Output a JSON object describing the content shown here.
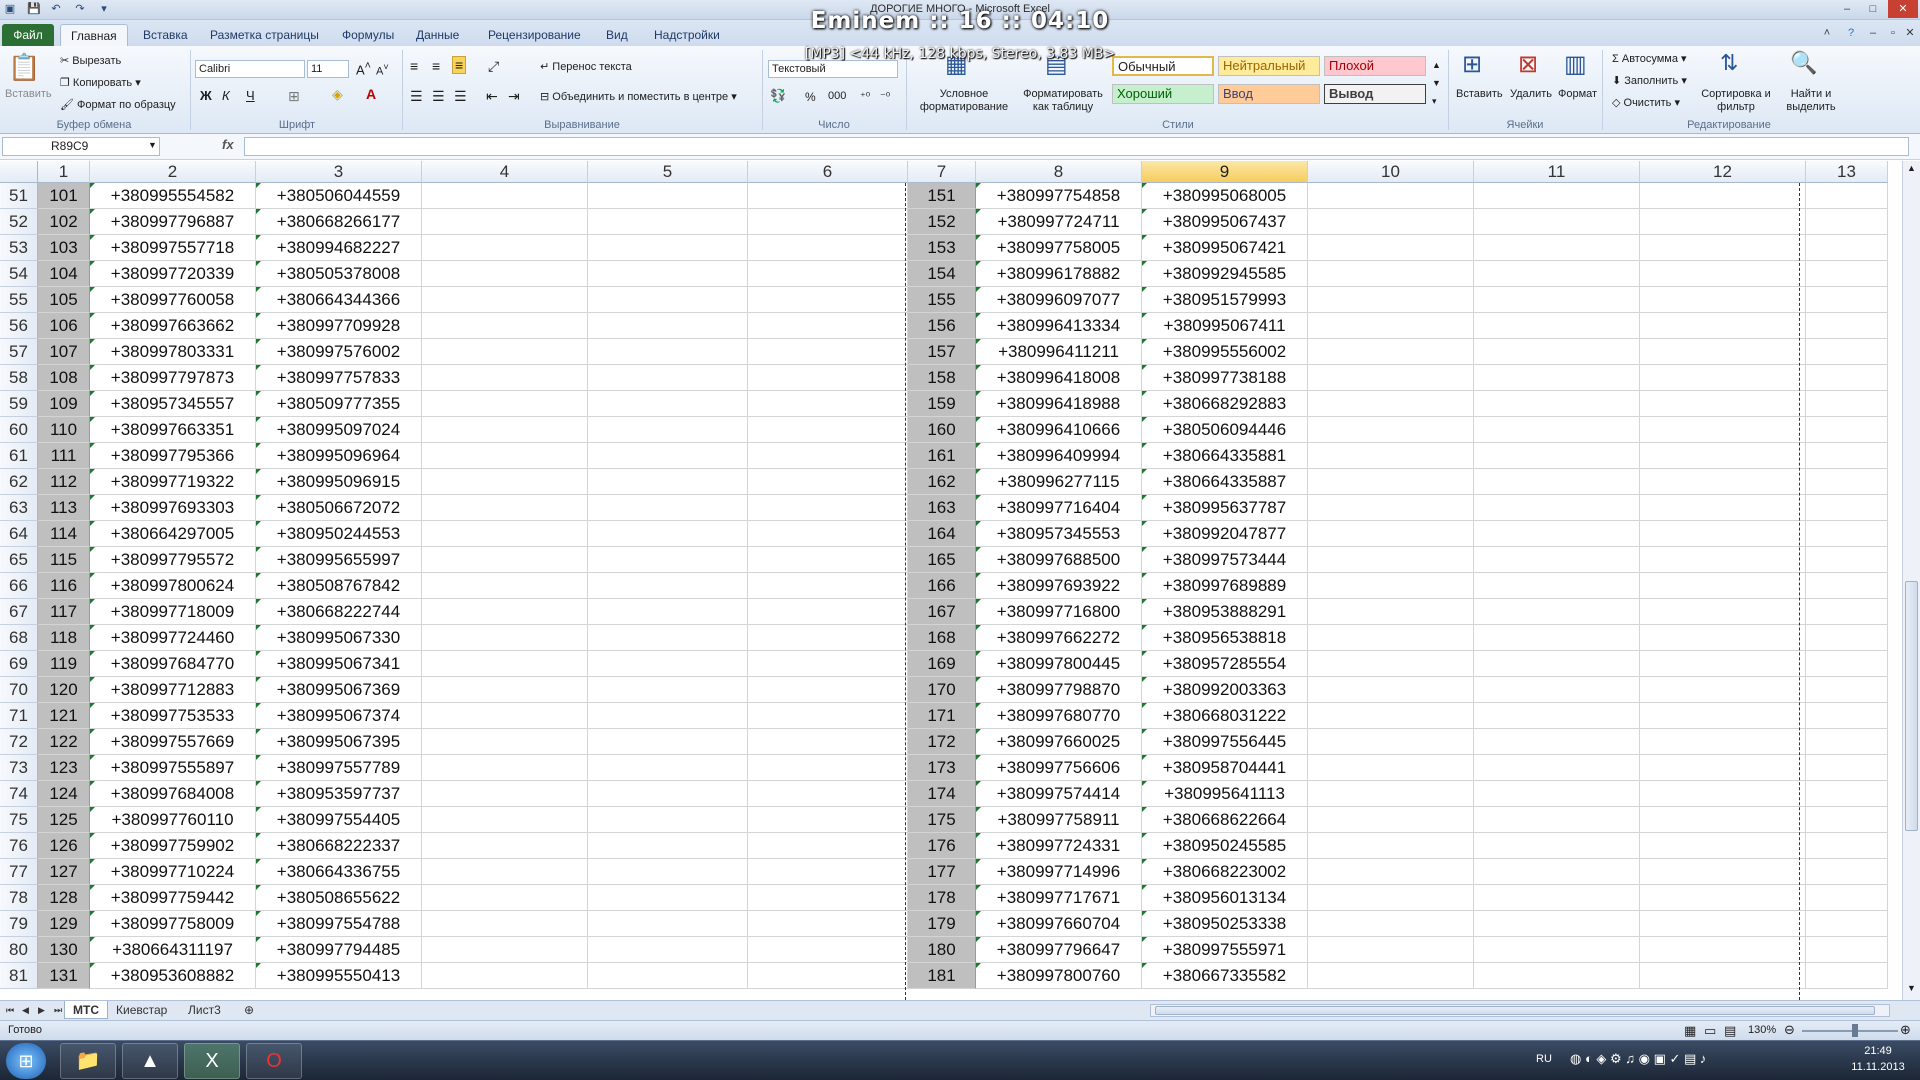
{
  "window": {
    "title": "ДОРОГИЕ МНОГО - Microsoft Excel"
  },
  "overlay": {
    "title": "Eminem :: 16 :: 04:10",
    "subtitle": "[MP3] <44 kHz, 128 kbps, Stereo, 3.83 MB>"
  },
  "tabs": [
    "Файл",
    "Главная",
    "Вставка",
    "Разметка страницы",
    "Формулы",
    "Данные",
    "Рецензирование",
    "Вид",
    "Надстройки"
  ],
  "ribbon": {
    "clipboard": {
      "paste": "Вставить",
      "cut": "Вырезать",
      "copy": "Копировать",
      "format_painter": "Формат по образцу",
      "label": "Буфер обмена"
    },
    "font": {
      "name": "Calibri",
      "size": "11",
      "bold": "Ж",
      "italic": "К",
      "underline": "Ч",
      "label": "Шрифт"
    },
    "alignment": {
      "wrap": "Перенос текста",
      "merge": "Объединить и поместить в центре",
      "label": "Выравнивание"
    },
    "number": {
      "format": "Текстовый",
      "percent": "%",
      "thousands": "000",
      "label": "Число"
    },
    "styles": {
      "conditional": "Условное форматирование",
      "as_table": "Форматировать как таблицу",
      "normal": "Обычный",
      "neutral": "Нейтральный",
      "bad": "Плохой",
      "good": "Хороший",
      "input": "Ввод",
      "output": "Вывод",
      "label": "Стили"
    },
    "cells": {
      "insert": "Вставить",
      "delete": "Удалить",
      "format": "Формат",
      "label": "Ячейки"
    },
    "editing": {
      "autosum": "Автосумма",
      "fill": "Заполнить",
      "clear": "Очистить",
      "sort": "Сортировка и фильтр",
      "find": "Найти и выделить",
      "label": "Редактирование"
    }
  },
  "formula_bar": {
    "name_box": "R89C9",
    "fx": "fx",
    "value": ""
  },
  "columns": [
    "1",
    "2",
    "3",
    "4",
    "5",
    "6",
    "7",
    "8",
    "9",
    "10",
    "11",
    "12",
    "13"
  ],
  "selected_column": "9",
  "rows": [
    {
      "r": "51",
      "a": "101",
      "b": "+380995554582",
      "c": "+380506044559",
      "g": "151",
      "h": "+380997754858",
      "i": "+380995068005"
    },
    {
      "r": "52",
      "a": "102",
      "b": "+380997796887",
      "c": "+380668266177",
      "g": "152",
      "h": "+380997724711",
      "i": "+380995067437"
    },
    {
      "r": "53",
      "a": "103",
      "b": "+380997557718",
      "c": "+380994682227",
      "g": "153",
      "h": "+380997758005",
      "i": "+380995067421"
    },
    {
      "r": "54",
      "a": "104",
      "b": "+380997720339",
      "c": "+380505378008",
      "g": "154",
      "h": "+380996178882",
      "i": "+380992945585"
    },
    {
      "r": "55",
      "a": "105",
      "b": "+380997760058",
      "c": "+380664344366",
      "g": "155",
      "h": "+380996097077",
      "i": "+380951579993"
    },
    {
      "r": "56",
      "a": "106",
      "b": "+380997663662",
      "c": "+380997709928",
      "g": "156",
      "h": "+380996413334",
      "i": "+380995067411"
    },
    {
      "r": "57",
      "a": "107",
      "b": "+380997803331",
      "c": "+380997576002",
      "g": "157",
      "h": "+380996411211",
      "i": "+380995556002"
    },
    {
      "r": "58",
      "a": "108",
      "b": "+380997797873",
      "c": "+380997757833",
      "g": "158",
      "h": "+380996418008",
      "i": "+380997738188"
    },
    {
      "r": "59",
      "a": "109",
      "b": "+380957345557",
      "c": "+380509777355",
      "g": "159",
      "h": "+380996418988",
      "i": "+380668292883"
    },
    {
      "r": "60",
      "a": "110",
      "b": "+380997663351",
      "c": "+380995097024",
      "g": "160",
      "h": "+380996410666",
      "i": "+380506094446"
    },
    {
      "r": "61",
      "a": "111",
      "b": "+380997795366",
      "c": "+380995096964",
      "g": "161",
      "h": "+380996409994",
      "i": "+380664335881"
    },
    {
      "r": "62",
      "a": "112",
      "b": "+380997719322",
      "c": "+380995096915",
      "g": "162",
      "h": "+380996277115",
      "i": "+380664335887"
    },
    {
      "r": "63",
      "a": "113",
      "b": "+380997693303",
      "c": "+380506672072",
      "g": "163",
      "h": "+380997716404",
      "i": "+380995637787"
    },
    {
      "r": "64",
      "a": "114",
      "b": "+380664297005",
      "c": "+380950244553",
      "g": "164",
      "h": "+380957345553",
      "i": "+380992047877"
    },
    {
      "r": "65",
      "a": "115",
      "b": "+380997795572",
      "c": "+380995655997",
      "g": "165",
      "h": "+380997688500",
      "i": "+380997573444"
    },
    {
      "r": "66",
      "a": "116",
      "b": "+380997800624",
      "c": "+380508767842",
      "g": "166",
      "h": "+380997693922",
      "i": "+380997689889"
    },
    {
      "r": "67",
      "a": "117",
      "b": "+380997718009",
      "c": "+380668222744",
      "g": "167",
      "h": "+380997716800",
      "i": "+380953888291"
    },
    {
      "r": "68",
      "a": "118",
      "b": "+380997724460",
      "c": "+380995067330",
      "g": "168",
      "h": "+380997662272",
      "i": "+380956538818"
    },
    {
      "r": "69",
      "a": "119",
      "b": "+380997684770",
      "c": "+380995067341",
      "g": "169",
      "h": "+380997800445",
      "i": "+380957285554"
    },
    {
      "r": "70",
      "a": "120",
      "b": "+380997712883",
      "c": "+380995067369",
      "g": "170",
      "h": "+380997798870",
      "i": "+380992003363"
    },
    {
      "r": "71",
      "a": "121",
      "b": "+380997753533",
      "c": "+380995067374",
      "g": "171",
      "h": "+380997680770",
      "i": "+380668031222"
    },
    {
      "r": "72",
      "a": "122",
      "b": "+380997557669",
      "c": "+380995067395",
      "g": "172",
      "h": "+380997660025",
      "i": "+380997556445"
    },
    {
      "r": "73",
      "a": "123",
      "b": "+380997555897",
      "c": "+380997557789",
      "g": "173",
      "h": "+380997756606",
      "i": "+380958704441"
    },
    {
      "r": "74",
      "a": "124",
      "b": "+380997684008",
      "c": "+380953597737",
      "g": "174",
      "h": "+380997574414",
      "i": "+380995641113"
    },
    {
      "r": "75",
      "a": "125",
      "b": "+380997760110",
      "c": "+380997554405",
      "g": "175",
      "h": "+380997758911",
      "i": "+380668622664"
    },
    {
      "r": "76",
      "a": "126",
      "b": "+380997759902",
      "c": "+380668222337",
      "g": "176",
      "h": "+380997724331",
      "i": "+380950245585"
    },
    {
      "r": "77",
      "a": "127",
      "b": "+380997710224",
      "c": "+380664336755",
      "g": "177",
      "h": "+380997714996",
      "i": "+380668223002"
    },
    {
      "r": "78",
      "a": "128",
      "b": "+380997759442",
      "c": "+380508655622",
      "g": "178",
      "h": "+380997717671",
      "i": "+380956013134"
    },
    {
      "r": "79",
      "a": "129",
      "b": "+380997758009",
      "c": "+380997554788",
      "g": "179",
      "h": "+380997660704",
      "i": "+380950253338"
    },
    {
      "r": "80",
      "a": "130",
      "b": "+380664311197",
      "c": "+380997794485",
      "g": "180",
      "h": "+380997796647",
      "i": "+380997555971"
    },
    {
      "r": "81",
      "a": "131",
      "b": "+380953608882",
      "c": "+380995550413",
      "g": "181",
      "h": "+380997800760",
      "i": "+380667335582"
    }
  ],
  "sheets": [
    "МТС",
    "Киевстар",
    "Лист3"
  ],
  "status": {
    "ready": "Готово",
    "zoom": "130%"
  },
  "taskbar": {
    "lang": "RU",
    "time": "21:49",
    "date": "11.11.2013"
  },
  "colors": {
    "selected_header": "#f6cd5e",
    "gray_cell": "#bfbfbf",
    "file_tab": "#2b6f35"
  }
}
